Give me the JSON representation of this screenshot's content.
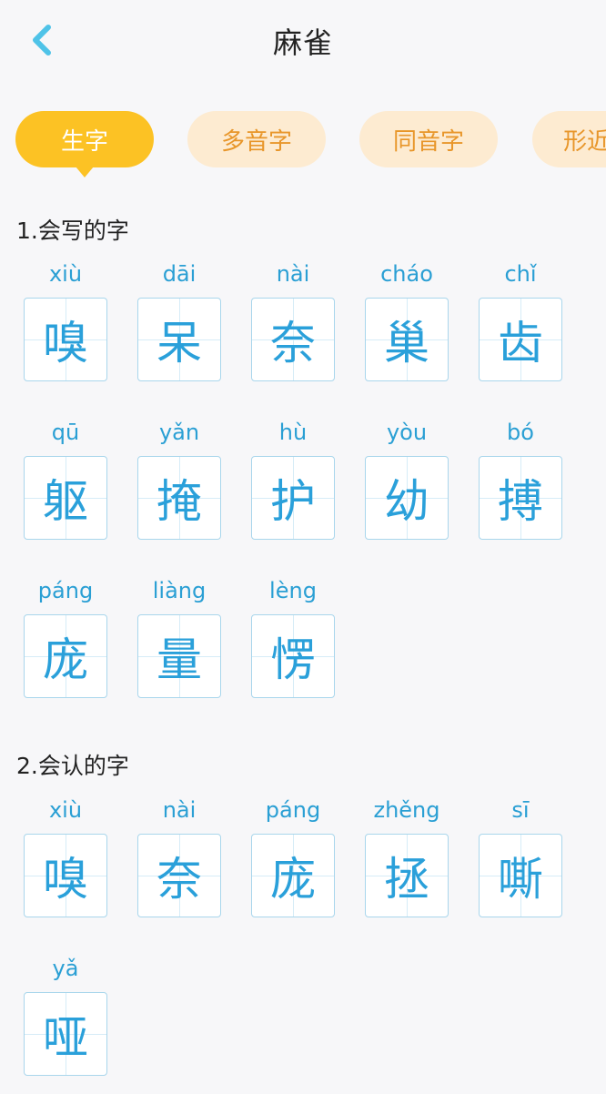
{
  "header": {
    "title": "麻雀",
    "back_icon": "chevron-left-icon",
    "accent_color": "#4fc3e8"
  },
  "tabs": [
    {
      "label": "生字",
      "active": true
    },
    {
      "label": "多音字",
      "active": false
    },
    {
      "label": "同音字",
      "active": false
    },
    {
      "label": "形近",
      "active": false
    }
  ],
  "sections": [
    {
      "title": "1.会写的字",
      "chars": [
        {
          "pinyin": "xiù",
          "char": "嗅"
        },
        {
          "pinyin": "dāi",
          "char": "呆"
        },
        {
          "pinyin": "nài",
          "char": "奈"
        },
        {
          "pinyin": "cháo",
          "char": "巢"
        },
        {
          "pinyin": "chǐ",
          "char": "齿"
        },
        {
          "pinyin": "qū",
          "char": "躯"
        },
        {
          "pinyin": "yǎn",
          "char": "掩"
        },
        {
          "pinyin": "hù",
          "char": "护"
        },
        {
          "pinyin": "yòu",
          "char": "幼"
        },
        {
          "pinyin": "bó",
          "char": "搏"
        },
        {
          "pinyin": "páng",
          "char": "庞"
        },
        {
          "pinyin": "liàng",
          "char": "量"
        },
        {
          "pinyin": "lèng",
          "char": "愣"
        }
      ]
    },
    {
      "title": "2.会认的字",
      "chars": [
        {
          "pinyin": "xiù",
          "char": "嗅"
        },
        {
          "pinyin": "nài",
          "char": "奈"
        },
        {
          "pinyin": "páng",
          "char": "庞"
        },
        {
          "pinyin": "zhěng",
          "char": "拯"
        },
        {
          "pinyin": "sī",
          "char": "嘶"
        },
        {
          "pinyin": "yǎ",
          "char": "哑"
        }
      ]
    }
  ]
}
